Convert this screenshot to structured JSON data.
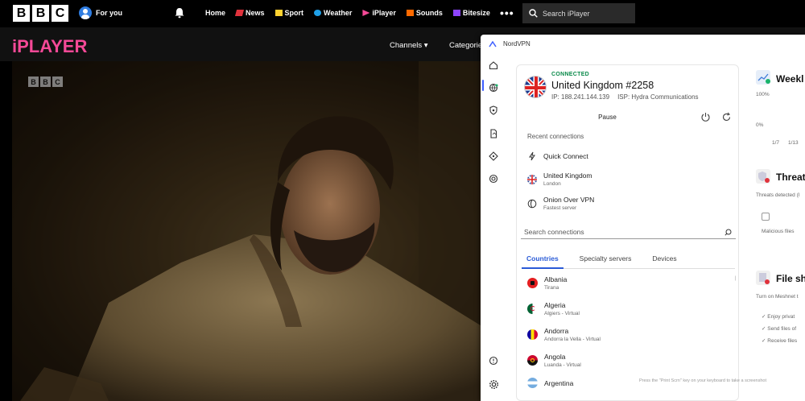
{
  "bbc_nav": {
    "logo_letters": [
      "B",
      "B",
      "C"
    ],
    "for_you": "For you",
    "links": [
      {
        "label": "Home",
        "icon": "none",
        "color": "#ffffff"
      },
      {
        "label": "News",
        "icon": "news-icon",
        "color": "#e0323c"
      },
      {
        "label": "Sport",
        "icon": "sport-icon",
        "color": "#ffd230"
      },
      {
        "label": "Weather",
        "icon": "weather-icon",
        "color": "#1fa0e8"
      },
      {
        "label": "iPlayer",
        "icon": "iplayer-icon",
        "color": "#f54997"
      },
      {
        "label": "Sounds",
        "icon": "sounds-icon",
        "color": "#ff6a00"
      },
      {
        "label": "Bitesize",
        "icon": "bitesize-icon",
        "color": "#8e44ff"
      }
    ],
    "more": "•••",
    "search_placeholder": "Search iPlayer"
  },
  "iplayer": {
    "logo": "iPLAYER",
    "channels": "Channels ▾",
    "categories": "Categories"
  },
  "video": {
    "watermark": [
      "B",
      "B",
      "C"
    ]
  },
  "vpn": {
    "app_name": "NordVPN",
    "status": "CONNECTED",
    "server": "United Kingdom #2258",
    "ip": "IP: 188.241.144.139",
    "isp": "ISP: Hydra Communications",
    "pause": "Pause",
    "recent_heading": "Recent connections",
    "quick_connect": "Quick Connect",
    "recent": [
      {
        "name": "United Kingdom",
        "sub": "London"
      },
      {
        "name": "Onion Over VPN",
        "sub": "Fastest server"
      }
    ],
    "search_placeholder": "Search connections",
    "tabs": [
      "Countries",
      "Specialty servers",
      "Devices"
    ],
    "countries": [
      {
        "name": "Albania",
        "sub": "Tirana"
      },
      {
        "name": "Algeria",
        "sub": "Algiers - Virtual"
      },
      {
        "name": "Andorra",
        "sub": "Andorra la Vella - Virtual"
      },
      {
        "name": "Angola",
        "sub": "Luanda - Virtual"
      },
      {
        "name": "Argentina",
        "sub": ""
      }
    ],
    "hint": "Press the \"Print Scrn\" key on your keyboard to take a screenshot",
    "right_panel": {
      "weekly": "Weekl",
      "pct_100": "100%",
      "pct_0": "0%",
      "dates": [
        "1/7",
        "1/13"
      ],
      "threat": "Threat",
      "threats_detected": "Threats detected (l",
      "malicious": "Malicious files",
      "file_share": "File sha",
      "meshnet": "Turn on Meshnet t",
      "bullets": [
        "Enjoy privat",
        "Send files of",
        "Receive files"
      ]
    },
    "accent": "#3e5fff"
  }
}
